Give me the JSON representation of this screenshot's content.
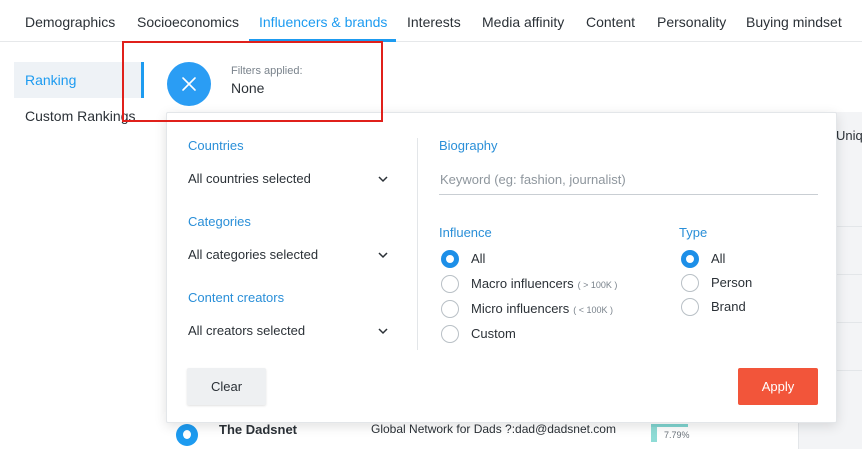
{
  "tabs": [
    {
      "label": "Demographics"
    },
    {
      "label": "Socioeconomics"
    },
    {
      "label": "Influencers & brands",
      "active": true
    },
    {
      "label": "Interests"
    },
    {
      "label": "Media affinity"
    },
    {
      "label": "Content"
    },
    {
      "label": "Personality"
    },
    {
      "label": "Buying mindset"
    }
  ],
  "sidebar": {
    "items": [
      {
        "label": "Ranking",
        "active": true
      },
      {
        "label": "Custom Rankings"
      }
    ]
  },
  "filters_header": {
    "label": "Filters applied:",
    "value": "None",
    "icon": "close-icon"
  },
  "background": {
    "column_head": "Uniqu",
    "row": {
      "name": "The Dadsnet",
      "bio": "Global Network for Dads ?:dad@dadsnet.com",
      "percent": "7.79%"
    }
  },
  "panel": {
    "countries": {
      "title": "Countries",
      "selected": "All countries selected"
    },
    "categories": {
      "title": "Categories",
      "selected": "All categories selected"
    },
    "creators": {
      "title": "Content creators",
      "selected": "All creators selected"
    },
    "biography": {
      "title": "Biography",
      "placeholder": "Keyword (eg: fashion, journalist)",
      "value": ""
    },
    "influence": {
      "title": "Influence",
      "options": [
        {
          "label": "All",
          "hint": "",
          "checked": true
        },
        {
          "label": "Macro influencers",
          "hint": "( > 100K )",
          "checked": false
        },
        {
          "label": "Micro influencers",
          "hint": "( < 100K )",
          "checked": false
        },
        {
          "label": "Custom",
          "hint": "",
          "checked": false
        }
      ]
    },
    "type": {
      "title": "Type",
      "options": [
        {
          "label": "All",
          "checked": true
        },
        {
          "label": "Person",
          "checked": false
        },
        {
          "label": "Brand",
          "checked": false
        }
      ]
    },
    "clear_label": "Clear",
    "apply_label": "Apply"
  },
  "colors": {
    "accent": "#1d9bf0",
    "apply": "#f2553a",
    "highlight_box": "#e0201b"
  }
}
